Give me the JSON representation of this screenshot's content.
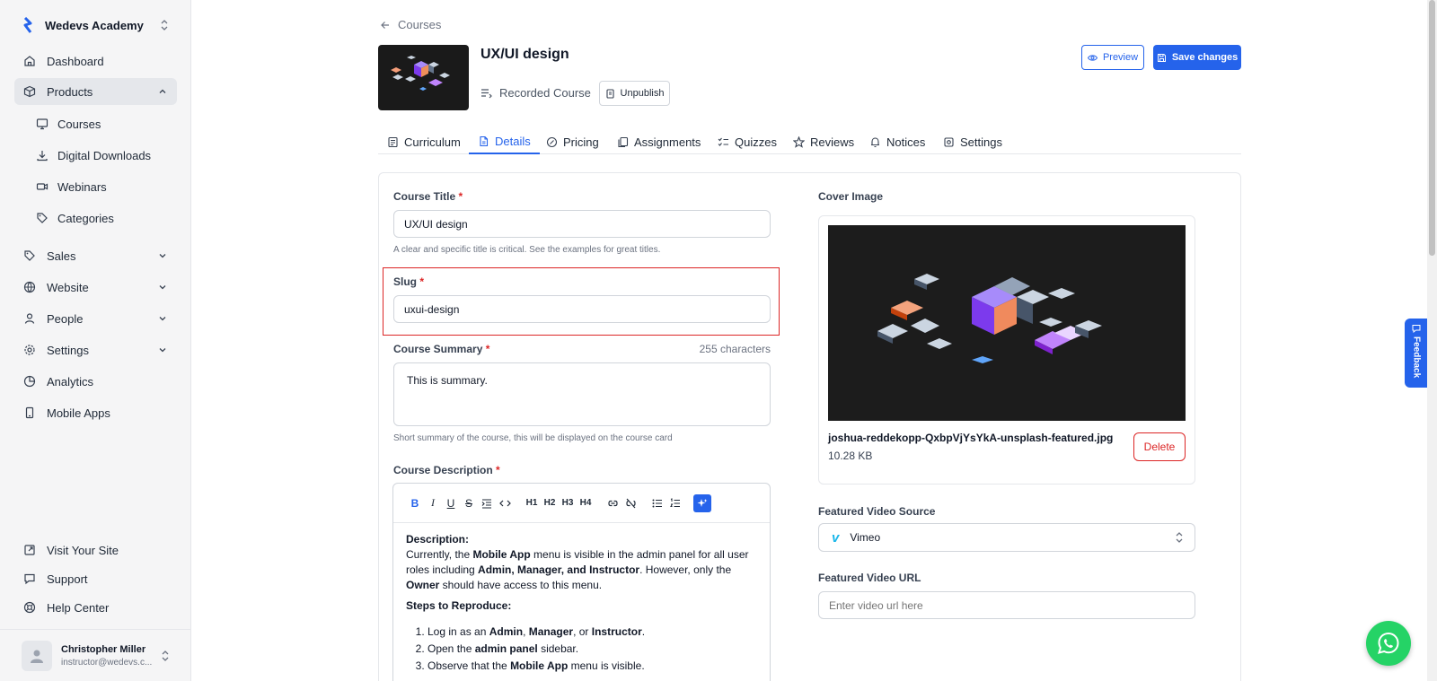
{
  "sidebar": {
    "brand": "Wedevs Academy",
    "nav": [
      {
        "label": "Dashboard",
        "icon": "home-icon"
      },
      {
        "label": "Products",
        "icon": "box-icon"
      },
      {
        "label": "Sales",
        "icon": "tag-icon"
      },
      {
        "label": "Website",
        "icon": "globe-icon"
      },
      {
        "label": "People",
        "icon": "user-icon"
      },
      {
        "label": "Settings",
        "icon": "gear-icon"
      },
      {
        "label": "Analytics",
        "icon": "pie-chart-icon"
      },
      {
        "label": "Mobile Apps",
        "icon": "mobile-icon"
      }
    ],
    "products_sub": [
      {
        "label": "Courses",
        "icon": "monitor-icon"
      },
      {
        "label": "Digital Downloads",
        "icon": "download-icon"
      },
      {
        "label": "Webinars",
        "icon": "video-icon"
      },
      {
        "label": "Categories",
        "icon": "tags-icon"
      }
    ],
    "footer": [
      {
        "label": "Visit Your Site",
        "icon": "external-link-icon"
      },
      {
        "label": "Support",
        "icon": "chat-icon"
      },
      {
        "label": "Help Center",
        "icon": "lifebuoy-icon"
      }
    ],
    "user": {
      "name": "Christopher Miller",
      "email": "instructor@wedevs.c..."
    }
  },
  "header": {
    "back_label": "Courses",
    "course_title": "UX/UI design",
    "course_type": "Recorded Course",
    "unpublish_label": "Unpublish",
    "preview_label": "Preview",
    "save_label": "Save changes"
  },
  "tabs": [
    {
      "label": "Curriculum",
      "icon": "curriculum-icon"
    },
    {
      "label": "Details",
      "icon": "file-icon"
    },
    {
      "label": "Pricing",
      "icon": "pricing-icon"
    },
    {
      "label": "Assignments",
      "icon": "copy-icon"
    },
    {
      "label": "Quizzes",
      "icon": "checklist-icon"
    },
    {
      "label": "Reviews",
      "icon": "star-icon"
    },
    {
      "label": "Notices",
      "icon": "bell-icon"
    },
    {
      "label": "Settings",
      "icon": "gear-icon"
    }
  ],
  "form": {
    "title_label": "Course Title",
    "title_value": "UX/UI design",
    "title_help": "A clear and specific title is critical. See the examples for great titles.",
    "slug_label": "Slug",
    "slug_value": "uxui-design",
    "summary_label": "Course Summary",
    "summary_count": "255 characters",
    "summary_value": "This is summary.",
    "summary_help": "Short summary of the course, this will be displayed on the course card",
    "description_label": "Course Description",
    "required_mark": "*"
  },
  "editor": {
    "toolbar": [
      "B",
      "I",
      "U",
      "S",
      "H1",
      "H2",
      "H3",
      "H4"
    ],
    "description_heading": "Description:",
    "p1_a": "Currently, the ",
    "p1_b": "Mobile App",
    "p1_c": " menu is visible in the admin panel for all user roles including ",
    "p1_d": "Admin, Manager, and Instructor",
    "p1_e": ". However, only the ",
    "p1_f": "Owner",
    "p1_g": " should have access to this menu.",
    "steps_heading": "Steps to Reproduce:",
    "step1_a": "Log in as an ",
    "step1_b": "Admin",
    "step1_c": ", ",
    "step1_d": "Manager",
    "step1_e": ", or ",
    "step1_f": "Instructor",
    "step1_g": ".",
    "step2_a": "Open the ",
    "step2_b": "admin panel",
    "step2_c": " sidebar.",
    "step3_a": "Observe that the ",
    "step3_b": "Mobile App",
    "step3_c": " menu is visible."
  },
  "cover": {
    "label": "Cover Image",
    "file_name": "joshua-reddekopp-QxbpVjYsYkA-unsplash-featured.jpg",
    "file_size": "10.28 KB",
    "delete_label": "Delete"
  },
  "video": {
    "source_label": "Featured Video Source",
    "source_value": "Vimeo",
    "url_label": "Featured Video URL",
    "url_placeholder": "Enter video url here"
  },
  "widgets": {
    "feedback_label": "Feedback"
  },
  "colors": {
    "accent": "#2563eb",
    "danger": "#dc2626",
    "whatsapp": "#25d366"
  }
}
